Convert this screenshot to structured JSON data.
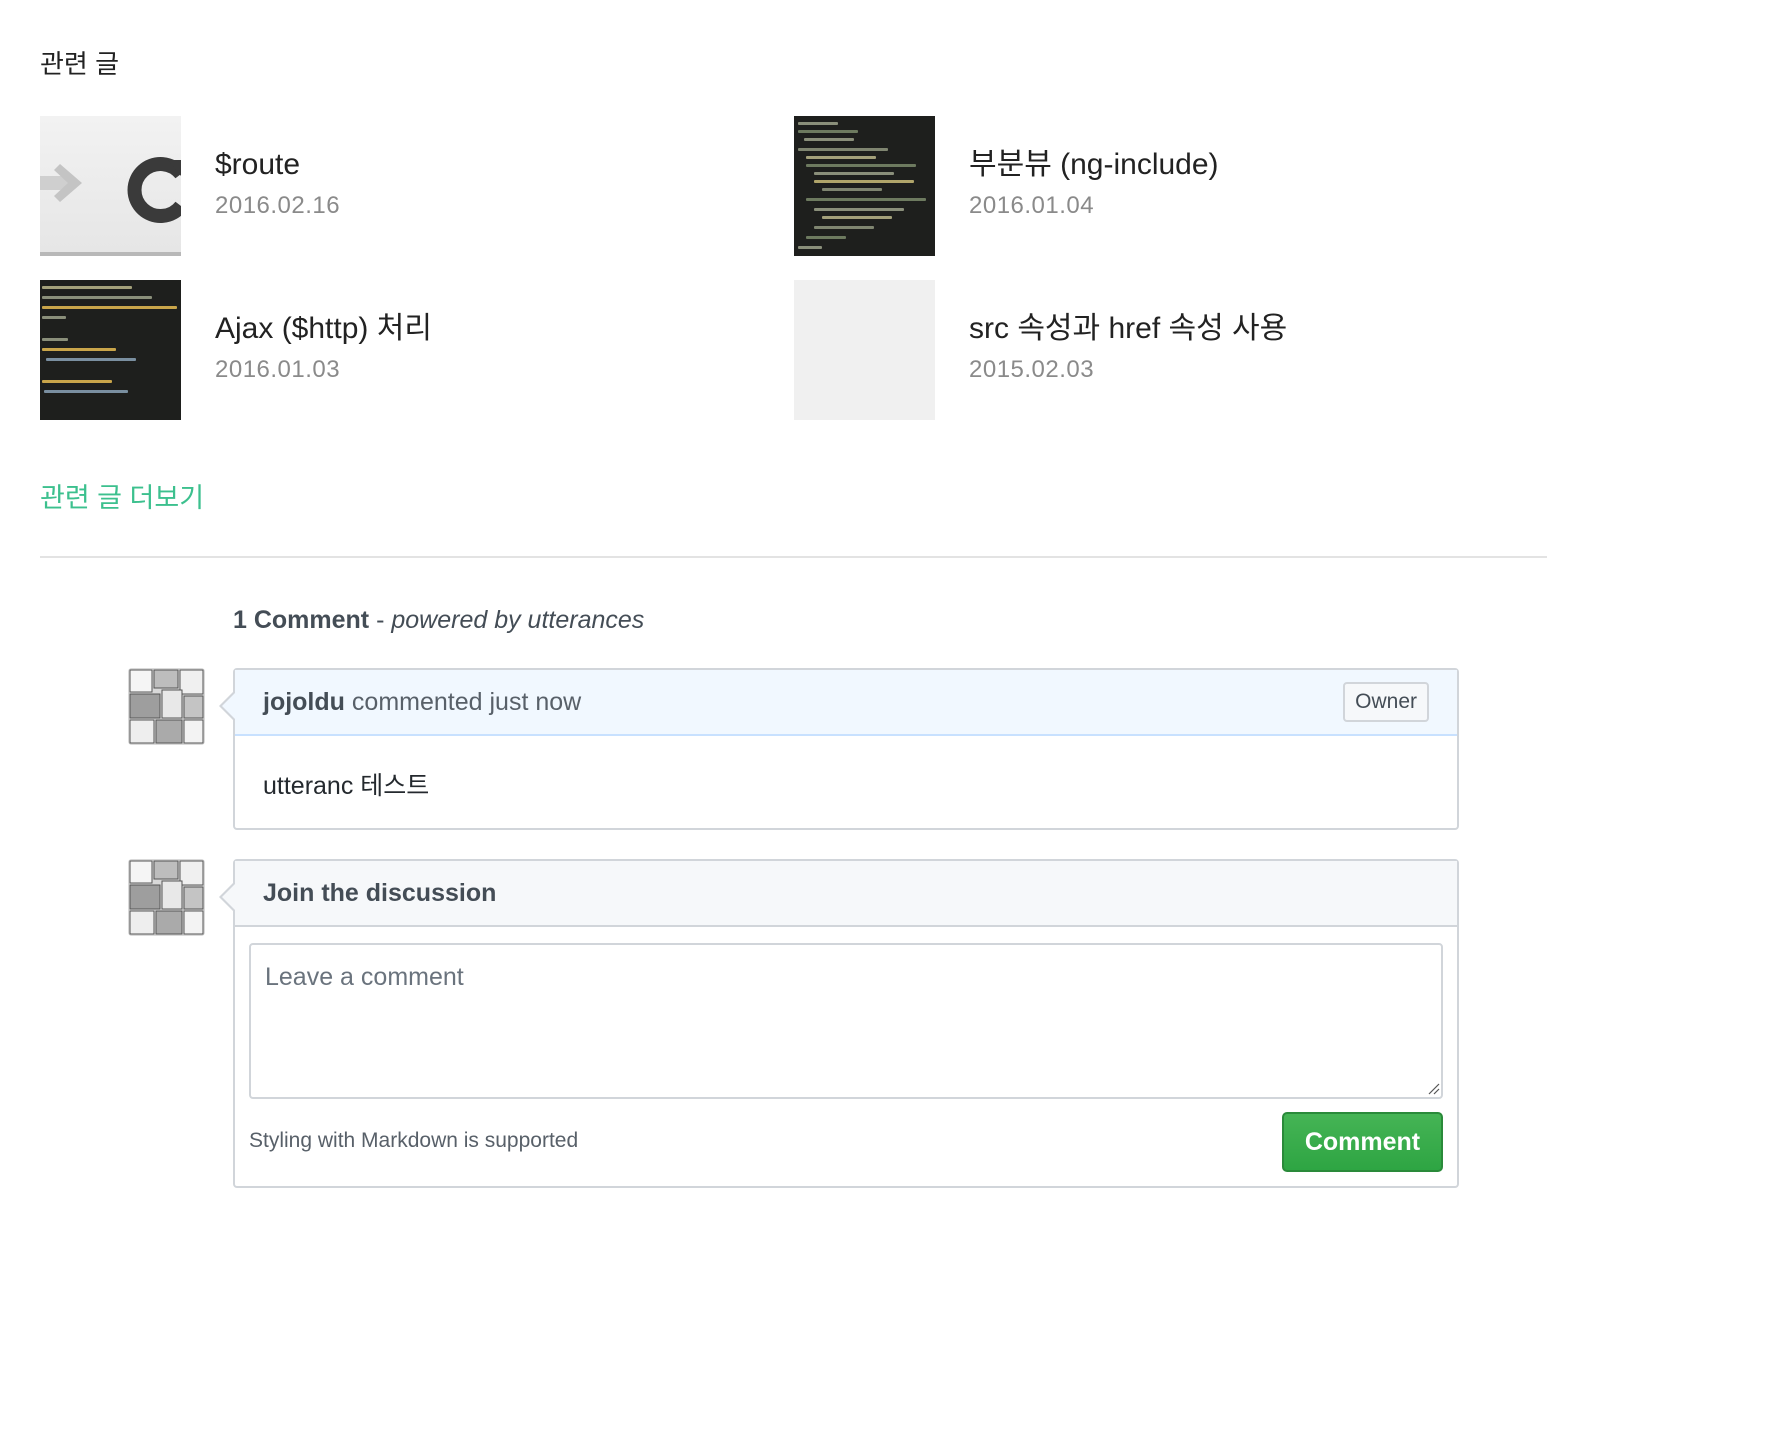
{
  "related": {
    "heading": "관련 글",
    "posts": [
      {
        "title": "$route",
        "date": "2016.02.16"
      },
      {
        "title": "부분뷰 (ng-include)",
        "date": "2016.01.04"
      },
      {
        "title": "Ajax ($http) 처리",
        "date": "2016.01.03"
      },
      {
        "title": "src 속성과 href 속성 사용",
        "date": "2015.02.03"
      }
    ],
    "more_link": "관련 글 더보기"
  },
  "comments": {
    "count_label": "1 Comment",
    "separator": " - ",
    "powered_by": "powered by utterances",
    "items": [
      {
        "author": "jojoldu",
        "action": "commented just now",
        "badge": "Owner",
        "body": "utteranc 테스트"
      }
    ],
    "form": {
      "title": "Join the discussion",
      "placeholder": "Leave a comment",
      "markdown_note": "Styling with Markdown is supported",
      "submit_label": "Comment"
    }
  },
  "colors": {
    "link": "#3cc08e",
    "submit": "#2ea543",
    "header_blue": "#f1f8ff"
  }
}
